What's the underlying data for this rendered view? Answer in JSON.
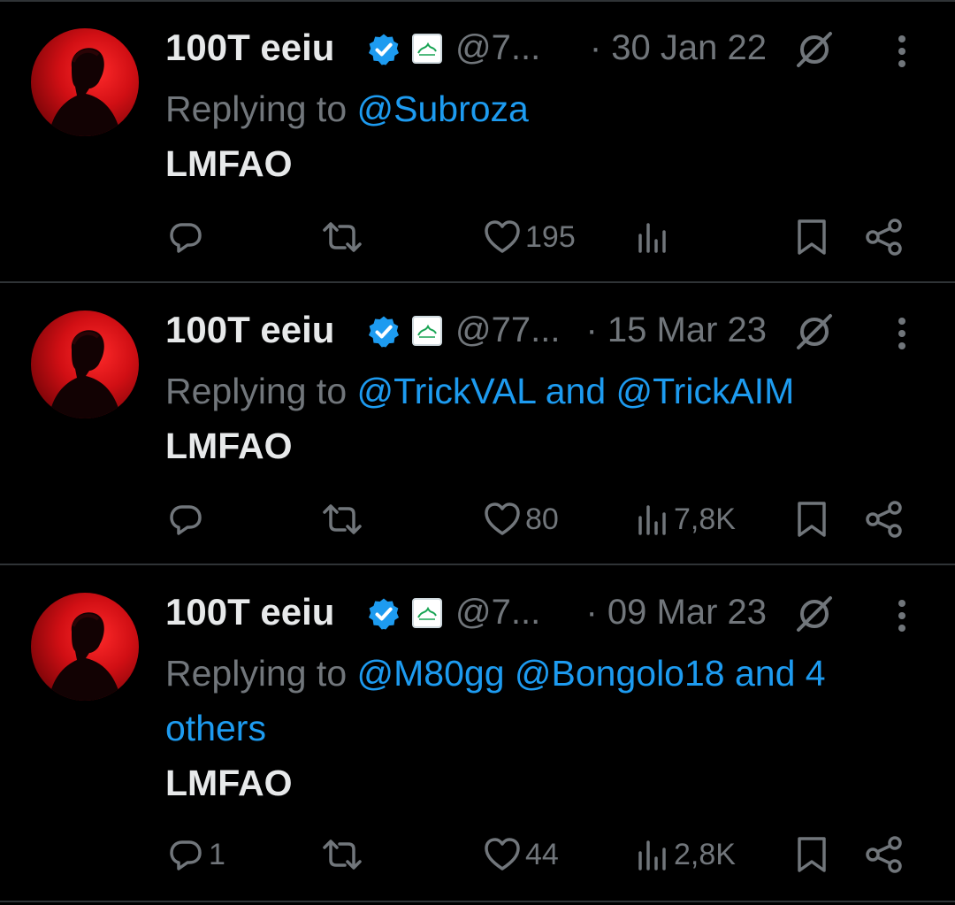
{
  "colors": {
    "background": "#000000",
    "text": "#e7e9ea",
    "muted": "#71767b",
    "accent": "#1d9bf0",
    "divider": "#2f3336",
    "avatar_red": "#d10f14"
  },
  "icons": {
    "reply": "reply-icon",
    "retweet": "retweet-icon",
    "like": "heart-icon",
    "views": "views-icon",
    "bookmark": "bookmark-icon",
    "share": "share-icon",
    "grok": "grok-icon",
    "more": "more-icon",
    "verified": "verified-badge-icon"
  },
  "tweets": [
    {
      "name": "100T eeiu",
      "handle": "@7...",
      "date": "· 30 Jan 22",
      "reply_prefix": "Replying to ",
      "mentions_line": "@Subroza",
      "mentions_line2": "",
      "text": "LMFAO",
      "replies": "",
      "likes": "195",
      "views": ""
    },
    {
      "name": "100T eeiu",
      "handle": "@77...",
      "date": "· 15 Mar 23",
      "reply_prefix": "Replying to ",
      "mentions_line": "@TrickVAL and @TrickAIM",
      "mentions_line2": "",
      "text": "LMFAO",
      "replies": "",
      "likes": "80",
      "views": "7,8K"
    },
    {
      "name": "100T eeiu",
      "handle": "@7...",
      "date": "· 09 Mar 23",
      "reply_prefix": "Replying to ",
      "mentions_line": "@M80gg @Bongolo18 and 4",
      "mentions_line2": "others",
      "text": "LMFAO",
      "replies": "1",
      "likes": "44",
      "views": "2,8K"
    }
  ]
}
